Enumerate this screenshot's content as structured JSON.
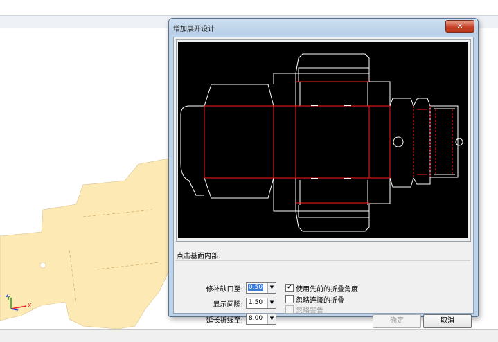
{
  "dialog": {
    "title": "增加展开设计",
    "close_label": "✕",
    "prompt": "点击基面内部.",
    "fields": [
      {
        "label": "修补缺口至:",
        "value": "0.50",
        "selected": true
      },
      {
        "label": "显示间隙:",
        "value": "1.50",
        "selected": false
      },
      {
        "label": "延长折线至:",
        "value": "8.00",
        "selected": false
      }
    ],
    "checkboxes": [
      {
        "label": "使用先前的折叠角度",
        "checked": true,
        "enabled": true
      },
      {
        "label": "忽略连接的折叠",
        "checked": false,
        "enabled": true
      },
      {
        "label": "忽略警告",
        "checked": false,
        "enabled": false
      }
    ],
    "ok_label": "确定",
    "cancel_label": "取消",
    "check_mark": "✔",
    "dropdown_arrow": "▼"
  },
  "colors": {
    "canvas_background": "#000000",
    "outline": "#ffffff",
    "fold_line": "#ff1a1a",
    "part_fill": "#fde9b4",
    "axis_x": "#e02020",
    "axis_y": "#20a020",
    "axis_z": "#2040e0"
  },
  "axis": {
    "x": "X",
    "y": "Y",
    "z": "Z"
  }
}
